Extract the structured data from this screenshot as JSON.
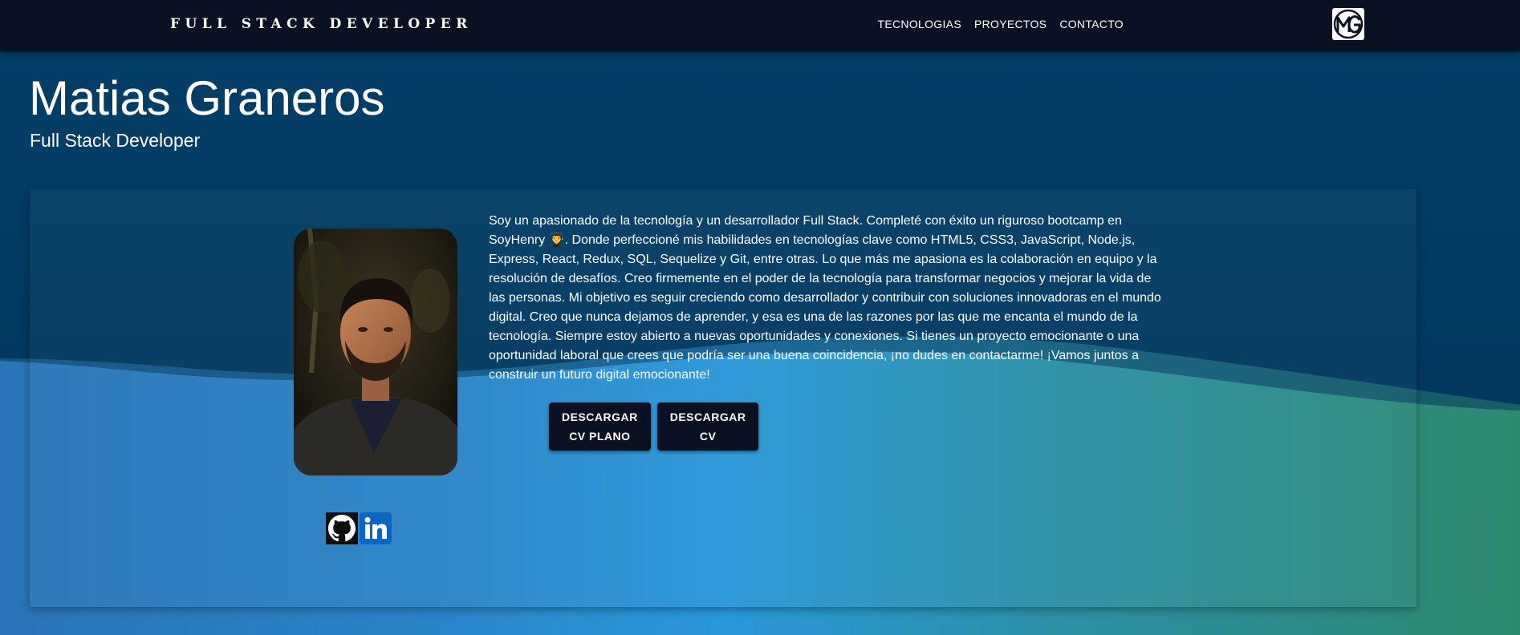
{
  "navbar": {
    "brand": "FULL STACK DEVELOPER",
    "links": [
      {
        "label": "TECNOLOGIAS"
      },
      {
        "label": "PROYECTOS"
      },
      {
        "label": "CONTACTO"
      }
    ],
    "logo_icon": "mg-logo-icon"
  },
  "hero": {
    "name": "Matias Graneros",
    "role": "Full Stack Developer"
  },
  "profile": {
    "photo_icon": "profile-photo",
    "bio": "Soy un apasionado de la tecnología y un desarrollador Full Stack. Completé con éxito un riguroso bootcamp en SoyHenry 👨‍🎓. Donde perfeccioné mis habilidades en tecnologías clave como HTML5, CSS3, JavaScript, Node.js, Express, React, Redux, SQL, Sequelize y Git, entre otras. Lo que más me apasiona es la colaboración en equipo y la resolución de desafíos. Creo firmemente en el poder de la tecnología para transformar negocios y mejorar la vida de las personas. Mi objetivo es seguir creciendo como desarrollador y contribuir con soluciones innovadoras en el mundo digital. Creo que nunca dejamos de aprender, y esa es una de las razones por las que me encanta el mundo de la tecnología. Siempre estoy abierto a nuevas oportunidades y conexiones. Si tienes un proyecto emocionante o una oportunidad laboral que crees que podría ser una buena coincidencia, ¡no dudes en contactarme! ¡Vamos juntos a construir un futuro digital emocionante!",
    "buttons": [
      {
        "line1": "DESCARGAR",
        "line2": "CV PLANO"
      },
      {
        "line1": "DESCARGAR",
        "line2": "CV"
      }
    ],
    "socials": [
      {
        "icon": "github-icon"
      },
      {
        "icon": "linkedin-icon"
      }
    ]
  },
  "colors": {
    "navbar": "#0a1122",
    "header_dark": "#03385e",
    "gradient_blue": "#2a98d9",
    "gradient_green": "#2e8a6e",
    "linkedin": "#0a66c2"
  }
}
